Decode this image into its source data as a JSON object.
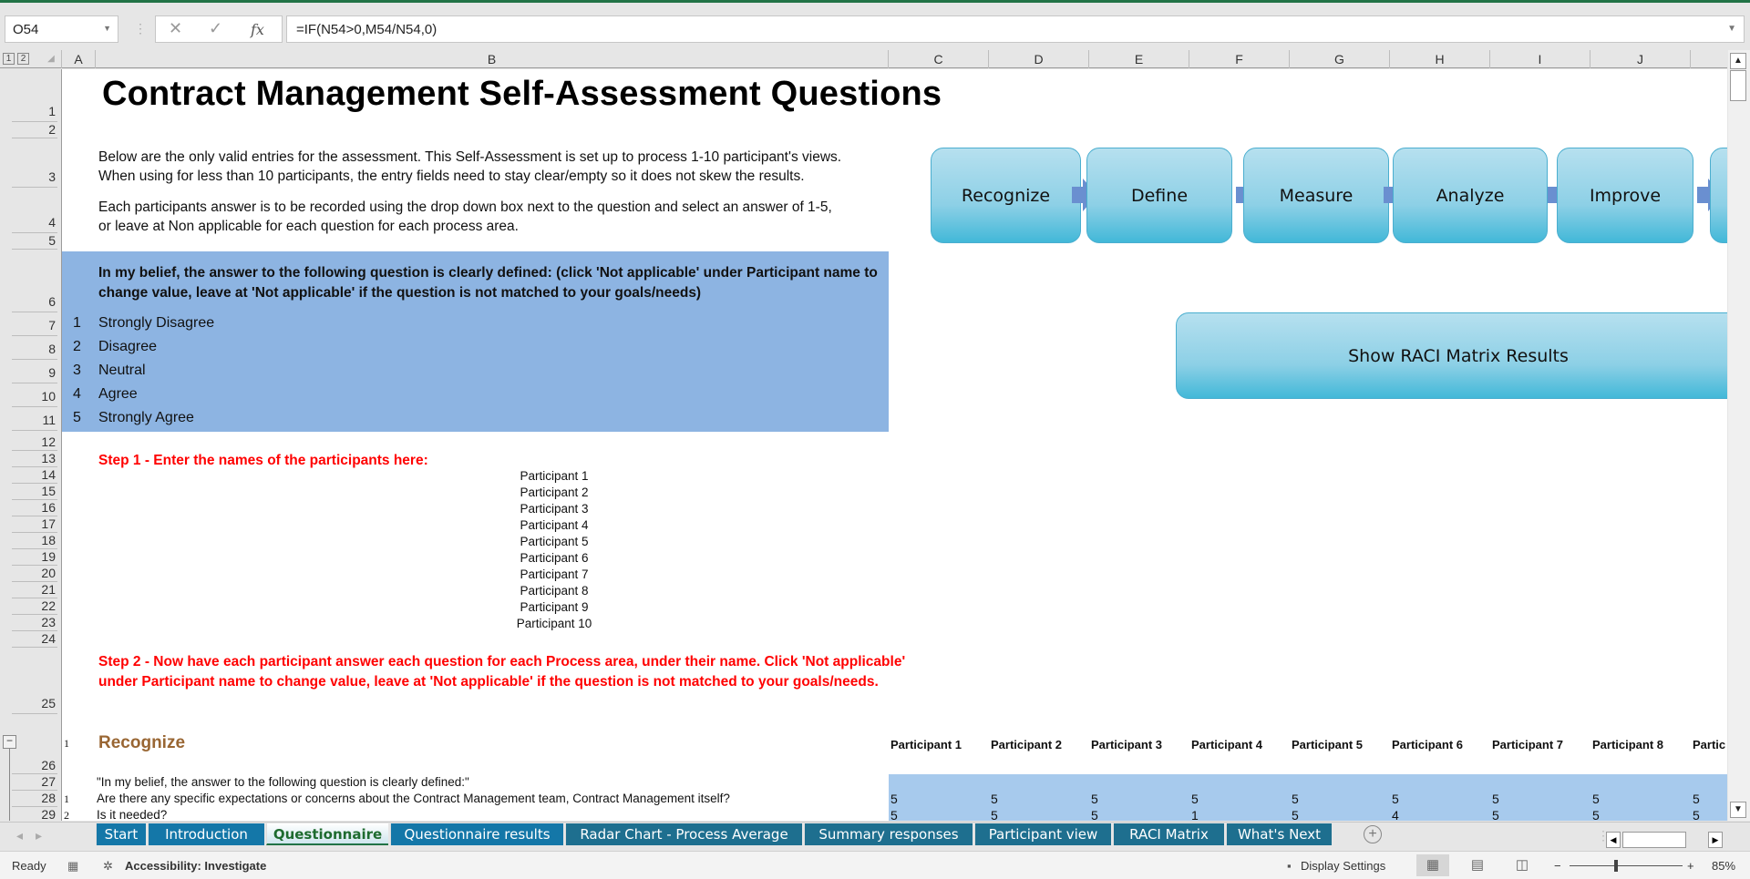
{
  "formula_bar": {
    "name_box": "O54",
    "cancel_icon": "✕",
    "enter_icon": "✓",
    "fx_label": "fx",
    "formula": "=IF(N54>0,M54/N54,0)"
  },
  "outline_levels": [
    "1",
    "2"
  ],
  "columns": [
    "A",
    "B",
    "C",
    "D",
    "E",
    "F",
    "G",
    "H",
    "I",
    "J"
  ],
  "rows_top": [
    "1",
    "2",
    "3",
    "4",
    "5",
    "6",
    "7",
    "8",
    "9",
    "10",
    "11",
    "12",
    "13",
    "14",
    "15",
    "16",
    "17",
    "18",
    "19",
    "20",
    "21",
    "22",
    "23",
    "24",
    "25"
  ],
  "rows_bottom": [
    "26",
    "27",
    "28",
    "29"
  ],
  "sheet": {
    "title": "Contract Management Self-Assessment Questions",
    "intro_1a": "Below are the only valid entries for the assessment. This Self-Assessment is set up to process 1-10 participant's views.",
    "intro_1b": "When using for less than 10 participants, the entry fields need to stay clear/empty so it does not skew the results.",
    "intro_2a": "Each participants answer is to be recorded using the drop down box next to the question and select an answer of 1-5,",
    "intro_2b": "or leave at Non applicable for each question for each process area.",
    "belief_question": "In my belief, the answer to the following question is clearly defined: (click 'Not applicable' under Participant name to change value, leave at 'Not applicable' if the question is not matched to your goals/needs)",
    "scale": [
      {
        "n": "1",
        "label": "Strongly Disagree"
      },
      {
        "n": "2",
        "label": "Disagree"
      },
      {
        "n": "3",
        "label": "Neutral"
      },
      {
        "n": "4",
        "label": "Agree"
      },
      {
        "n": "5",
        "label": "Strongly Agree"
      }
    ],
    "step1": "Step 1 - Enter the names of the participants here:",
    "participants": [
      "Participant 1",
      "Participant 2",
      "Participant 3",
      "Participant 4",
      "Participant 5",
      "Participant 6",
      "Participant 7",
      "Participant 8",
      "Participant 9",
      "Participant 10"
    ],
    "step2": "Step 2 - Now have each participant answer each question for each Process area, under their name. Click 'Not applicable' under Participant name to change value, leave at 'Not applicable' if the question is not matched to your goals/needs.",
    "section_number": "1",
    "section_title": "Recognize",
    "participant_headers": [
      "Participant 1",
      "Participant 2",
      "Participant 3",
      "Participant 4",
      "Participant 5",
      "Participant 6",
      "Participant 7",
      "Participant 8",
      "Partic"
    ],
    "belief_quote": "\"In my belief, the answer to the following question is clearly defined:\"",
    "questions": [
      {
        "n": "1",
        "text": "Are there any specific expectations or concerns about the Contract Management team, Contract Management itself?",
        "answers": [
          "5",
          "5",
          "5",
          "5",
          "5",
          "5",
          "5",
          "5",
          "5"
        ]
      },
      {
        "n": "2",
        "text": "Is it needed?",
        "answers": [
          "5",
          "5",
          "5",
          "1",
          "5",
          "4",
          "5",
          "5",
          "5"
        ]
      }
    ]
  },
  "process_flow": [
    "Recognize",
    "Define",
    "Measure",
    "Analyze",
    "Improve"
  ],
  "raci_button": "Show RACI Matrix Results",
  "tabs": [
    {
      "label": "Start",
      "active": false
    },
    {
      "label": "Introduction",
      "active": false
    },
    {
      "label": "Questionnaire",
      "active": true
    },
    {
      "label": "Questionnaire results",
      "active": false
    },
    {
      "label": "Radar Chart - Process Average",
      "active": false
    },
    {
      "label": "Summary responses",
      "active": false
    },
    {
      "label": "Participant view",
      "active": false
    },
    {
      "label": "RACI Matrix",
      "active": false
    },
    {
      "label": "What's Next",
      "active": false
    }
  ],
  "status": {
    "ready": "Ready",
    "accessibility": "Accessibility: Investigate",
    "display_settings": "Display Settings",
    "zoom": "85%"
  },
  "colors": {
    "excel_green": "#217346",
    "info_blue": "#8db4e2",
    "answer_blue": "#a7caed",
    "step_red": "#ff0000",
    "section_brown": "#996633",
    "tab_blue": "#1477a8"
  }
}
